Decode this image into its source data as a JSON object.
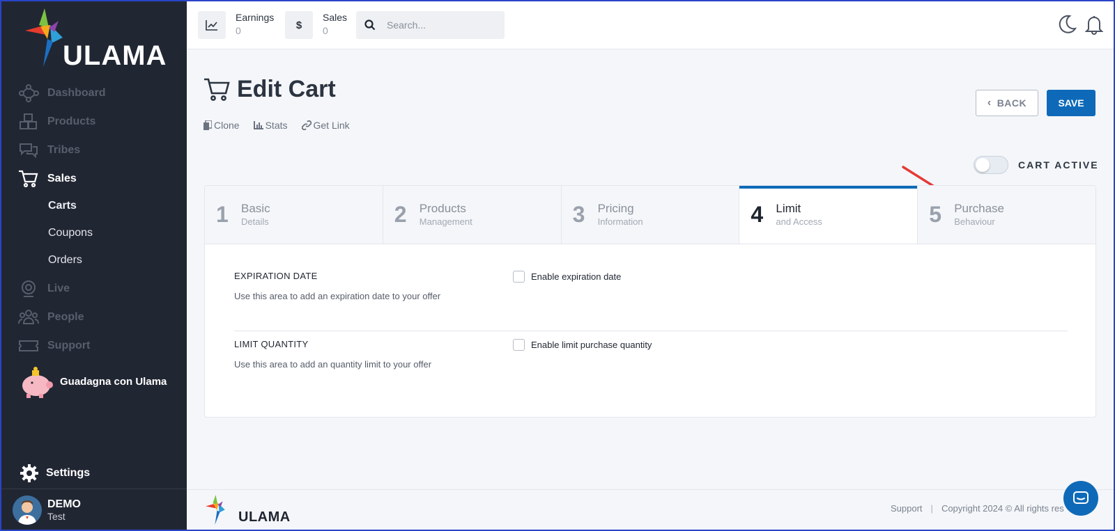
{
  "brand": {
    "name": "ULAMA"
  },
  "sidebar": {
    "items": [
      {
        "label": "Dashboard",
        "icon": "network-icon"
      },
      {
        "label": "Products",
        "icon": "boxes-icon"
      },
      {
        "label": "Tribes",
        "icon": "chat-bubbles-icon"
      },
      {
        "label": "Sales",
        "icon": "cart-icon"
      },
      {
        "label": "Live",
        "icon": "webcam-icon"
      },
      {
        "label": "People",
        "icon": "people-icon"
      },
      {
        "label": "Support",
        "icon": "ticket-icon"
      }
    ],
    "sub_items": [
      "Carts",
      "Coupons",
      "Orders"
    ],
    "promo": "Guadagna con Ulama",
    "settings": "Settings",
    "user": {
      "name": "DEMO",
      "sub": "Test"
    }
  },
  "topbar": {
    "earnings": {
      "label": "Earnings",
      "value": "0"
    },
    "sales": {
      "label": "Sales",
      "value": "0",
      "icon_text": "$"
    },
    "search": {
      "placeholder": "Search..."
    }
  },
  "page": {
    "title": "Edit Cart",
    "actions": [
      "Clone",
      "Stats",
      "Get Link"
    ],
    "back_label": "BACK",
    "save_label": "SAVE",
    "toggle_label": "CART ACTIVE",
    "toggle_on": false
  },
  "steps": [
    {
      "num": "1",
      "title": "Basic",
      "sub": "Details"
    },
    {
      "num": "2",
      "title": "Products",
      "sub": "Management"
    },
    {
      "num": "3",
      "title": "Pricing",
      "sub": "Information"
    },
    {
      "num": "4",
      "title": "Limit",
      "sub": "and Access"
    },
    {
      "num": "5",
      "title": "Purchase",
      "sub": "Behaviour"
    }
  ],
  "active_step": 4,
  "sections": [
    {
      "title": "EXPIRATION DATE",
      "desc": "Use this area to add an expiration date to your offer",
      "checkbox": "Enable expiration date",
      "checked": false
    },
    {
      "title": "LIMIT QUANTITY",
      "desc": "Use this area to add an quantity limit to your offer",
      "checkbox": "Enable limit purchase quantity",
      "checked": false
    }
  ],
  "footer": {
    "support": "Support",
    "copyright": "Copyright 2024 © All rights res"
  },
  "colors": {
    "sidebar_bg": "#212633",
    "accent": "#0e6ab8",
    "annotation_arrow": "#e53935"
  }
}
